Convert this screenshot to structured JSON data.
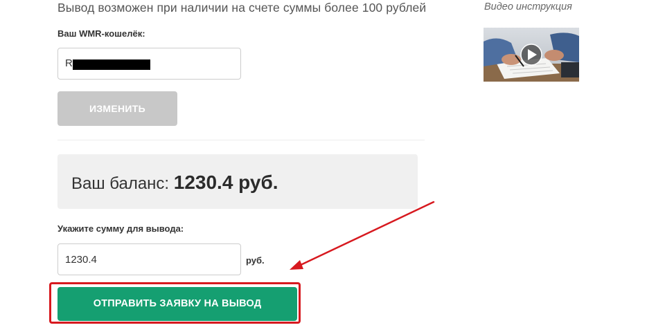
{
  "withdraw": {
    "info_text": "Вывод возможен при наличии на счете суммы более 100 рублей",
    "wallet_label": "Ваш WMR-кошелёк:",
    "wallet_value": "R",
    "change_button": "ИЗМЕНИТЬ",
    "balance_label": "Ваш баланс:",
    "balance_value": "1230.4 руб.",
    "amount_label": "Укажите сумму для вывода:",
    "amount_value": "1230.4",
    "currency_suffix": "руб.",
    "submit_button": "ОТПРАВИТЬ ЗАЯВКУ НА ВЫВОД"
  },
  "sidebar": {
    "video_title": "Видео инструкция",
    "video_thumbnail_icon": "play-icon"
  },
  "colors": {
    "submit_green": "#159f71",
    "change_gray": "#c8c8c8",
    "annotation_red": "#d7191f",
    "balance_bg": "#f0f0f0"
  }
}
